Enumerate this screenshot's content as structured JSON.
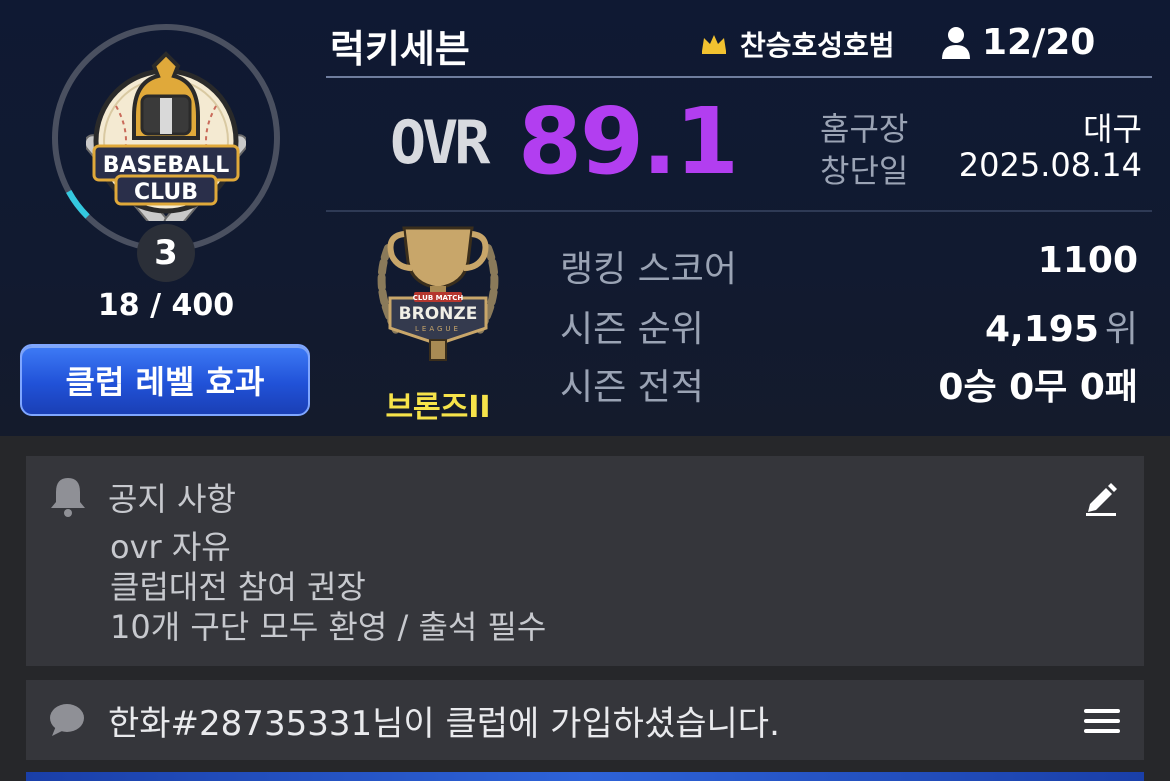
{
  "club": {
    "name": "럭키세븐",
    "leader_name": "찬승호성호범",
    "members": "12/20",
    "level": "3",
    "exp": "18 / 400",
    "exp_progress": 0.045,
    "level_effect_button": "클럽 레벨 효과",
    "emblem_text_line1": "BASEBALL",
    "emblem_text_line2": "CLUB"
  },
  "ovr": {
    "label": "OVR",
    "value": "89.1",
    "color": "#b23ef0"
  },
  "info": {
    "home_label": "홈구장",
    "home_value": "대구",
    "founded_label": "창단일",
    "founded_value": "2025.08.14"
  },
  "tier": {
    "name": "브론즈II",
    "badge_top": "CLUB MATCH",
    "badge_main": "BRONZE",
    "badge_sub": "LEAGUE"
  },
  "stats": {
    "ranking_label": "랭킹 스코어",
    "ranking_value": "1100",
    "season_rank_label": "시즌 순위",
    "season_rank_value": "4,195",
    "season_rank_unit": "위",
    "season_record_label": "시즌 전적",
    "season_record_value": "0승 0무 0패"
  },
  "notice": {
    "title": "공지 사항",
    "lines": [
      "ovr 자유",
      "클럽대전 참여 권장",
      "10개 구단 모두 환영 / 출석 필수"
    ]
  },
  "message": {
    "text": "한화#28735331님이 클럽에 가입하셨습니다."
  },
  "icons": {
    "crown": "crown-icon",
    "member": "person-icon",
    "bell": "bell-icon",
    "edit": "pencil-icon",
    "chat": "chat-bubble-icon",
    "menu": "hamburger-menu-icon"
  },
  "colors": {
    "accent_blue": "#2152d8",
    "tier_yellow": "#f6e34a",
    "crown_gold": "#f2c230"
  }
}
